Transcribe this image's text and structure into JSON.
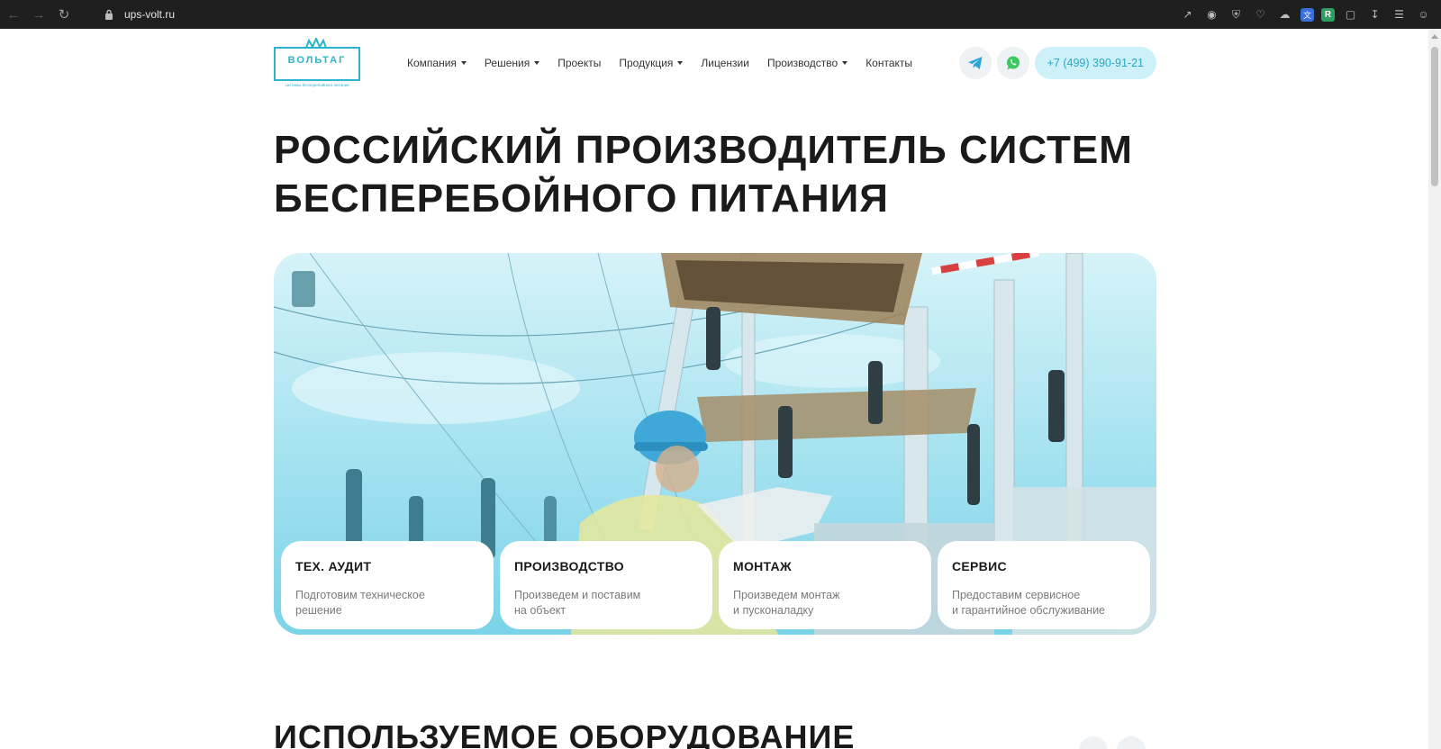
{
  "browser": {
    "url": "ups-volt.ru"
  },
  "logo": {
    "word": "ВОЛЬТАГ",
    "tagline": "системы бесперебойного питания"
  },
  "nav": [
    {
      "label": "Компания",
      "dropdown": true
    },
    {
      "label": "Решения",
      "dropdown": true
    },
    {
      "label": "Проекты",
      "dropdown": false
    },
    {
      "label": "Продукция",
      "dropdown": true
    },
    {
      "label": "Лицензии",
      "dropdown": false
    },
    {
      "label": "Производство",
      "dropdown": true
    },
    {
      "label": "Контакты",
      "dropdown": false
    }
  ],
  "contacts": {
    "phone": "+7 (499) 390-91-21",
    "telegram_icon": "telegram-icon",
    "whatsapp_icon": "whatsapp-icon"
  },
  "headline": {
    "line1": "РОССИЙСКИЙ ПРОИЗВОДИТЕЛЬ СИСТЕМ",
    "line2": "БЕСПЕРЕБОЙНОГО ПИТАНИЯ"
  },
  "services": [
    {
      "title": "ТЕХ. АУДИТ",
      "desc": "Подготовим техническое\nрешение"
    },
    {
      "title": "ПРОИЗВОДСТВО",
      "desc": "Произведем и поставим\nна объект"
    },
    {
      "title": "МОНТАЖ",
      "desc": "Произведем монтаж\nи пусконаладку"
    },
    {
      "title": "СЕРВИС",
      "desc": "Предоставим сервисное\nи гарантийное обслуживание"
    }
  ],
  "section2": {
    "title": "ИСПОЛЬЗУЕМОЕ ОБОРУДОВАНИЕ"
  },
  "colors": {
    "accent": "#2bb3c9",
    "phone_bg": "#cdf0f9",
    "phone_text": "#24a9c5",
    "telegram": "#2aa7d8",
    "whatsapp": "#3cc760"
  }
}
